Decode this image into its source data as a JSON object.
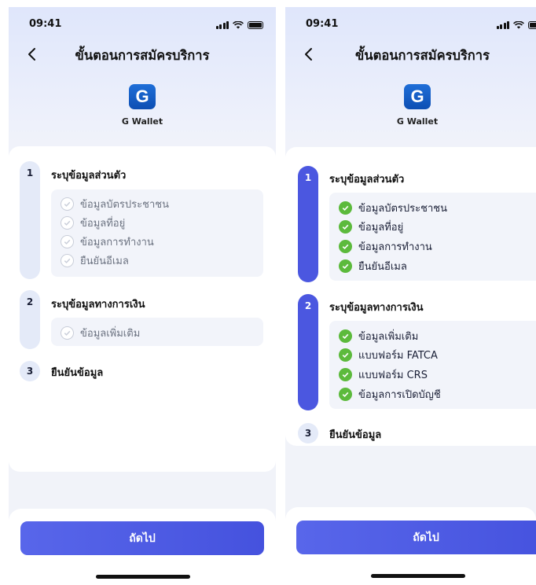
{
  "colors": {
    "accent": "#4b57e0",
    "check_done": "#5cba3c",
    "check_idle": "#c9ced9",
    "rail_idle": "#e4eaf8",
    "logo": "#1565c0"
  },
  "screens": [
    {
      "status": {
        "time": "09:41",
        "icons": [
          "signal-icon",
          "wifi-icon",
          "battery-icon"
        ]
      },
      "header": {
        "back_icon": "chevron-left-icon",
        "title": "ขั้นตอนการสมัครบริการ"
      },
      "app": {
        "logo_letter": "G",
        "name": "G Wallet"
      },
      "steps": [
        {
          "number": "1",
          "title": "ระบุข้อมูลส่วนตัว",
          "state": "idle",
          "items": [
            {
              "label": "ข้อมูลบัตรประชาชน",
              "checked": false
            },
            {
              "label": "ข้อมูลที่อยู่",
              "checked": false
            },
            {
              "label": "ข้อมูลการทำงาน",
              "checked": false
            },
            {
              "label": "ยืนยันอีเมล",
              "checked": false
            }
          ]
        },
        {
          "number": "2",
          "title": "ระบุข้อมูลทางการเงิน",
          "state": "idle",
          "items": [
            {
              "label": "ข้อมูลเพิ่มเติม",
              "checked": false
            }
          ]
        },
        {
          "number": "3",
          "title": "ยืนยันข้อมูล",
          "state": "idle",
          "items": []
        }
      ],
      "next_button": "ถัดไป"
    },
    {
      "status": {
        "time": "09:41",
        "icons": [
          "signal-icon",
          "wifi-icon",
          "battery-icon"
        ]
      },
      "header": {
        "back_icon": "chevron-left-icon",
        "title": "ขั้นตอนการสมัครบริการ"
      },
      "app": {
        "logo_letter": "G",
        "name": "G Wallet"
      },
      "steps": [
        {
          "number": "1",
          "title": "ระบุข้อมูลส่วนตัว",
          "state": "done",
          "items": [
            {
              "label": "ข้อมูลบัตรประชาชน",
              "checked": true
            },
            {
              "label": "ข้อมูลที่อยู่",
              "checked": true
            },
            {
              "label": "ข้อมูลการทำงาน",
              "checked": true
            },
            {
              "label": "ยืนยันอีเมล",
              "checked": true
            }
          ]
        },
        {
          "number": "2",
          "title": "ระบุข้อมูลทางการเงิน",
          "state": "done",
          "items": [
            {
              "label": "ข้อมูลเพิ่มเติม",
              "checked": true
            },
            {
              "label": "แบบฟอร์ม FATCA",
              "checked": true
            },
            {
              "label": "แบบฟอร์ม CRS",
              "checked": true
            },
            {
              "label": "ข้อมูลการเปิดบัญชี",
              "checked": true
            }
          ]
        },
        {
          "number": "3",
          "title": "ยืนยันข้อมูล",
          "state": "idle",
          "items": []
        }
      ],
      "next_button": "ถัดไป"
    }
  ]
}
